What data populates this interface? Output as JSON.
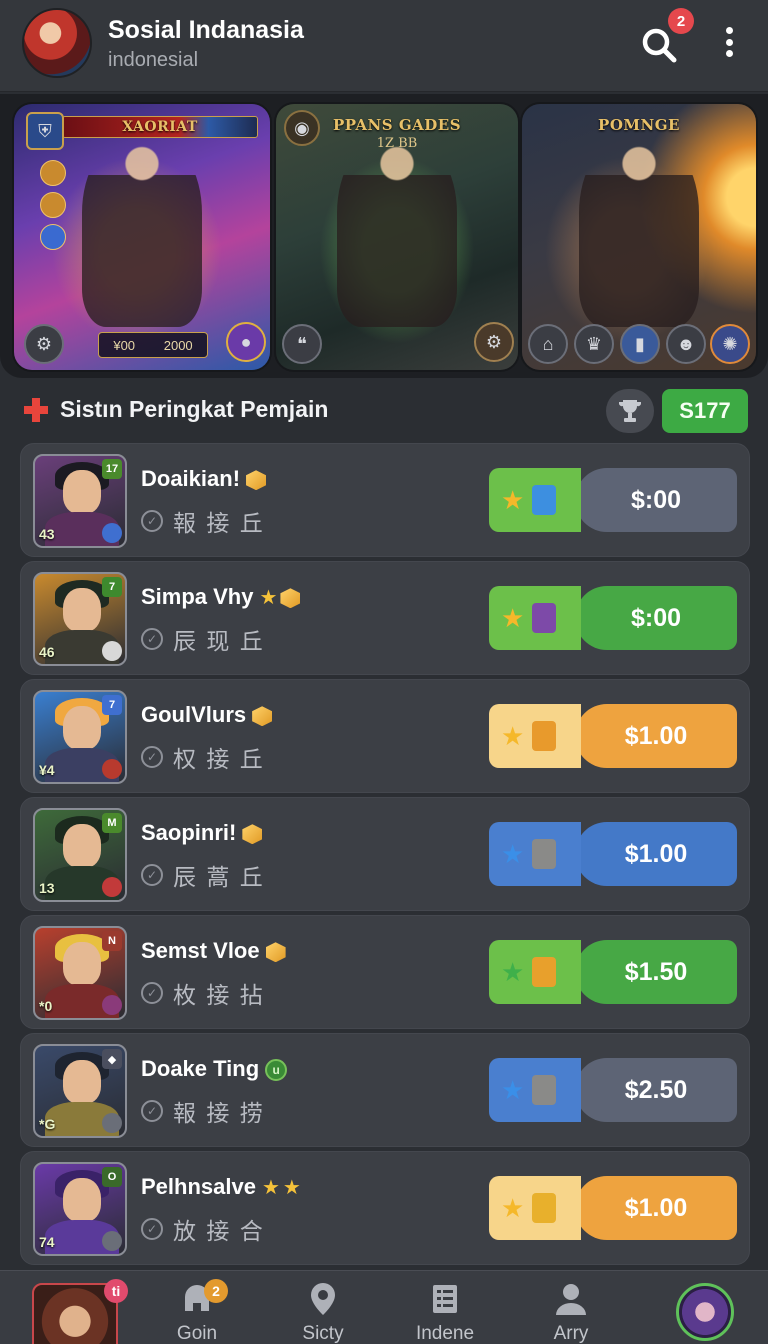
{
  "header": {
    "title": "Sosial Indanasia",
    "subtitle": "indonesial",
    "notification_count": "2"
  },
  "hero": {
    "cards": [
      {
        "label": "XAORIAT",
        "score_left": "¥00",
        "score_right": "2000"
      },
      {
        "label": "PPANS GADES",
        "sublabel": "1Z BB"
      },
      {
        "label": "POMNGE"
      }
    ]
  },
  "section": {
    "title": "Sistın Peringkat Pemjain",
    "balance": "S177"
  },
  "players": [
    {
      "name": "Doaikian!",
      "sub": "報 接 丘",
      "level": "43",
      "corner_top": "17",
      "price": "$:00",
      "pill": "pill-green-grey",
      "item_color": "#3d8fe0",
      "colors": {
        "frame": "#6a3f7a",
        "hair": "#1b1a22",
        "body": "#5a2f5c",
        "corner": "#4a8a2c",
        "corner2": "#3f6fd0"
      }
    },
    {
      "name": "Simpa Vhy",
      "sub": "辰 现 丘",
      "level": "46",
      "corner_top": "7",
      "price": "$:00",
      "pill": "pill-green",
      "item_color": "#7d4aa8",
      "colors": {
        "frame": "#c98a2e",
        "hair": "#1e2a22",
        "body": "#3a3a32",
        "corner": "#3e8a2e",
        "corner2": "#d8d8d8"
      }
    },
    {
      "name": "GoulVlurs",
      "sub": "权 接 丘",
      "level": "¥4",
      "corner_top": "7",
      "price": "$1.00",
      "pill": "pill-orange",
      "item_color": "#e89a2c",
      "colors": {
        "frame": "#3a7fd0",
        "hair": "#f0a840",
        "body": "#3b3f62",
        "corner": "#3f6fd0",
        "corner2": "#b83a2e"
      }
    },
    {
      "name": "Saopinri!",
      "sub": "辰 蒿 丘",
      "level": "13",
      "corner_top": "M",
      "price": "$1.00",
      "pill": "pill-blue",
      "item_color": "#8a8a88",
      "colors": {
        "frame": "#3e6a3a",
        "hair": "#1c2a1e",
        "body": "#26382a",
        "corner": "#4a8a2c",
        "corner2": "#c23a3a"
      }
    },
    {
      "name": "Semst Vloe",
      "sub": "枚 接 拈",
      "level": "*0",
      "corner_top": "N",
      "price": "$1.50",
      "pill": "pill-green",
      "item_color": "#e8a02c",
      "colors": {
        "frame": "#b8402e",
        "hair": "#e8c040",
        "body": "#7a2a2a",
        "corner": "#9a3a2e",
        "corner2": "#8a3a7a"
      }
    },
    {
      "name": "Doake Ting",
      "sub": "報 接 捞",
      "level": "*G",
      "corner_top": "◆",
      "price": "$2.50",
      "pill": "pill-blue-grey",
      "item_color": "#8a8a88",
      "colors": {
        "frame": "#3a4a6a",
        "hair": "#1e2430",
        "body": "#8a7a3a",
        "corner": "#4a4e5e",
        "corner2": "#6a6e78"
      }
    },
    {
      "name": "Pelhnsalve",
      "sub": "放 接 合",
      "level": "74",
      "corner_top": "O",
      "price": "$1.00",
      "pill": "pill-orange",
      "item_color": "#e8b02c",
      "colors": {
        "frame": "#6a3aa8",
        "hair": "#3a2268",
        "body": "#5a3a9a",
        "corner": "#3a6a2a",
        "corner2": "#6a6e78"
      }
    }
  ],
  "nav": {
    "avatar_badge": "ti",
    "items": [
      {
        "label": "Goin",
        "badge": "2"
      },
      {
        "label": "Sicty"
      },
      {
        "label": "Indene"
      },
      {
        "label": "Arry"
      }
    ]
  },
  "icons": {
    "search": "search-icon",
    "more": "more-vertical-icon",
    "section": "plus-icon",
    "trophy": "trophy-icon",
    "check": "check-circle-icon",
    "star": "star-icon"
  },
  "colors": {
    "background": "#2b2e33",
    "row": "#3c3f45",
    "green": "#47a845",
    "orange": "#eea33f",
    "blue": "#4479c8",
    "accent_red": "#e5484d"
  }
}
